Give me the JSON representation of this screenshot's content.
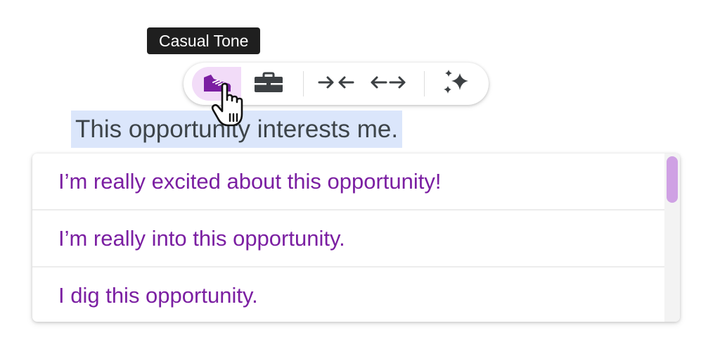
{
  "tooltip": {
    "text": "Casual Tone"
  },
  "toolbar": {
    "buttons": [
      {
        "icon": "sneaker-icon",
        "label": "Casual Tone",
        "active": true
      },
      {
        "icon": "briefcase-icon",
        "label": "Formal Tone",
        "active": false
      },
      {
        "icon": "shorten-icon",
        "label": "Shorten",
        "active": false
      },
      {
        "icon": "elaborate-icon",
        "label": "Elaborate",
        "active": false
      },
      {
        "icon": "sparkle-icon",
        "label": "Rephrase",
        "active": false
      }
    ]
  },
  "selected_text": "This opportunity interests me.",
  "suggestions": [
    "I’m really excited about this opportunity!",
    "I’m really into this opportunity.",
    "I dig this opportunity."
  ],
  "colors": {
    "accent": "#7b1fa2",
    "active_button_bg": "#f2dcf8",
    "selection_bg": "#dbe6fb",
    "tooltip_bg": "#1f1f1f",
    "scroll_thumb": "#cfa1e4",
    "icon": "#3c4043"
  }
}
